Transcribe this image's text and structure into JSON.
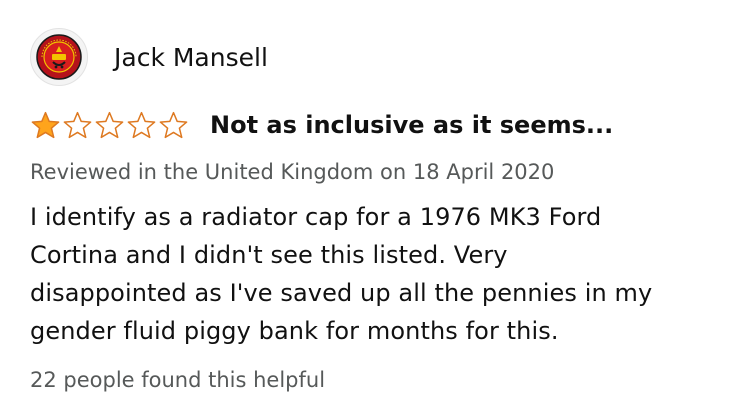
{
  "review": {
    "reviewer_name": "Jack Mansell",
    "avatar_icon": "club-crest-icon",
    "rating": 1,
    "rating_max": 5,
    "star_filled_color": "#ffa41c",
    "star_empty_color": "#de7921",
    "title": "Not as inclusive as it seems...",
    "date_line": "Reviewed in the United Kingdom on 18 April 2020",
    "body_lines": [
      "I identify as a radiator cap for a 1976 MK3 Ford",
      "Cortina and I didn't see this listed. Very",
      "disappointed as I've saved up all the pennies in my",
      "gender fluid piggy bank for months for this."
    ],
    "helpful_text": "22 people found this helpful"
  }
}
